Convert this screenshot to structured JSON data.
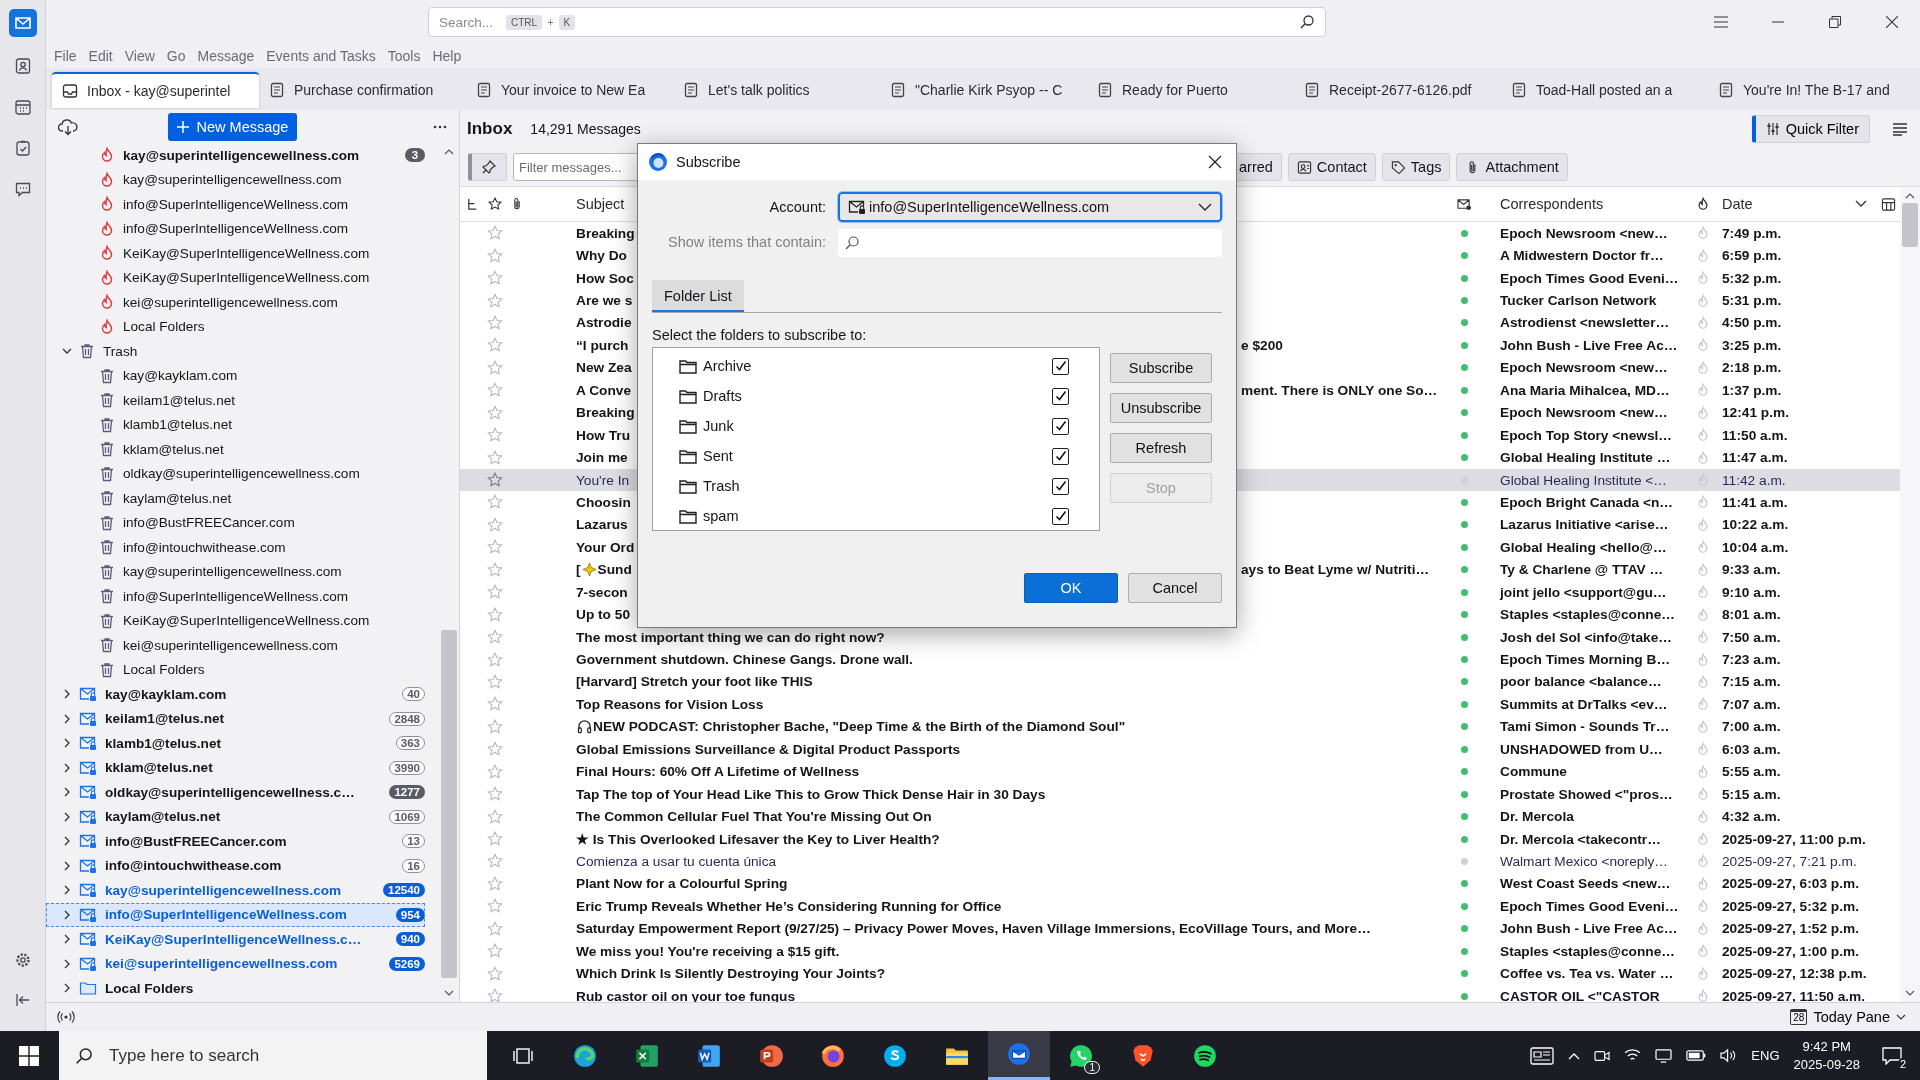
{
  "window": {
    "search_placeholder": "Search...",
    "search_keys": [
      {
        "label": "CTRL",
        "kind": "key"
      },
      {
        "label": "+",
        "kind": "plus"
      },
      {
        "label": "K",
        "kind": "key"
      }
    ]
  },
  "spaces": [
    {
      "kind": "contacts",
      "selected": false
    },
    {
      "kind": "calendar",
      "selected": false
    },
    {
      "kind": "tasks",
      "selected": false
    },
    {
      "kind": "chat",
      "selected": false
    }
  ],
  "menu": [
    "File",
    "Edit",
    "View",
    "Go",
    "Message",
    "Events and Tasks",
    "Tools",
    "Help"
  ],
  "tabs": [
    {
      "label": "Inbox - kay@superintel",
      "kind": "inbox",
      "selected": true
    },
    {
      "label": "Purchase confirmation",
      "kind": "message",
      "selected": false
    },
    {
      "label": "Your invoice to New Ea",
      "kind": "message",
      "selected": false
    },
    {
      "label": "Let's talk politics",
      "kind": "message",
      "selected": false
    },
    {
      "label": "\"Charlie Kirk Psyop -- C",
      "kind": "message",
      "selected": false
    },
    {
      "label": "Ready for Puerto",
      "kind": "message",
      "selected": false
    },
    {
      "label": "Receipt-2677-6126.pdf",
      "kind": "message",
      "selected": false
    },
    {
      "label": "Toad-Hall posted an a",
      "kind": "message",
      "selected": false
    },
    {
      "label": "You're In! The B-17 and",
      "kind": "message",
      "selected": false
    }
  ],
  "folder_pane": {
    "new_message": "New Message",
    "tree": [
      {
        "children": [
          {
            "name": "kay@superintelligencewellness.com",
            "kind": "junk",
            "unread": true,
            "selected": false,
            "count": "3",
            "filled": true
          },
          {
            "name": "kay@superintelligencewellness.com",
            "kind": "junk",
            "unread": false,
            "selected": false
          },
          {
            "name": "info@SuperIntelligenceWellness.com",
            "kind": "junk",
            "unread": false,
            "selected": false
          },
          {
            "name": "info@SuperIntelligenceWellness.com",
            "kind": "junk",
            "unread": false,
            "selected": false
          },
          {
            "name": "KeiKay@SuperIntelligenceWellness.com",
            "kind": "junk",
            "unread": false,
            "selected": false
          },
          {
            "name": "KeiKay@SuperIntelligenceWellness.com",
            "kind": "junk",
            "unread": false,
            "selected": false
          },
          {
            "name": "kei@superintelligencewellness.com",
            "kind": "junk",
            "unread": false,
            "selected": false
          },
          {
            "name": "Local Folders",
            "kind": "junk",
            "unread": false,
            "selected": false
          }
        ]
      },
      {
        "name": "Trash",
        "kind": "trash",
        "expanded": true,
        "unread": false,
        "selected": false,
        "children": [
          {
            "name": "kay@kayklam.com",
            "kind": "trash",
            "unread": false,
            "selected": false
          },
          {
            "name": "keilam1@telus.net",
            "kind": "trash",
            "unread": false,
            "selected": false
          },
          {
            "name": "klamb1@telus.net",
            "kind": "trash",
            "unread": false,
            "selected": false
          },
          {
            "name": "kklam@telus.net",
            "kind": "trash",
            "unread": false,
            "selected": false
          },
          {
            "name": "oldkay@superintelligencewellness.com",
            "kind": "trash",
            "unread": false,
            "selected": false
          },
          {
            "name": "kaylam@telus.net",
            "kind": "trash",
            "unread": false,
            "selected": false
          },
          {
            "name": "info@BustFREECancer.com",
            "kind": "trash",
            "unread": false,
            "selected": false
          },
          {
            "name": "info@intouchwithease.com",
            "kind": "trash",
            "unread": false,
            "selected": false
          },
          {
            "name": "kay@superintelligencewellness.com",
            "kind": "trash",
            "unread": false,
            "selected": false
          },
          {
            "name": "info@SuperIntelligenceWellness.com",
            "kind": "trash",
            "unread": false,
            "selected": false
          },
          {
            "name": "KeiKay@SuperIntelligenceWellness.com",
            "kind": "trash",
            "unread": false,
            "selected": false
          },
          {
            "name": "kei@superintelligencewellness.com",
            "kind": "trash",
            "unread": false,
            "selected": false
          },
          {
            "name": "Local Folders",
            "kind": "trash",
            "unread": false,
            "selected": false
          }
        ]
      },
      {
        "name": "kay@kayklam.com",
        "kind": "account",
        "expanded": false,
        "unread": true,
        "new_mail": false,
        "selected": false,
        "count": "40",
        "filled": false
      },
      {
        "name": "keilam1@telus.net",
        "kind": "account",
        "expanded": false,
        "unread": true,
        "new_mail": false,
        "selected": false,
        "count": "2848",
        "filled": false
      },
      {
        "name": "klamb1@telus.net",
        "kind": "account",
        "expanded": false,
        "unread": true,
        "new_mail": false,
        "selected": false,
        "count": "363",
        "filled": false
      },
      {
        "name": "kklam@telus.net",
        "kind": "account",
        "expanded": false,
        "unread": true,
        "new_mail": false,
        "selected": false,
        "count": "3990",
        "filled": false
      },
      {
        "name": "oldkay@superintelligencewellness.c…",
        "kind": "account",
        "expanded": false,
        "unread": true,
        "new_mail": false,
        "selected": false,
        "count": "1277",
        "filled": true
      },
      {
        "name": "kaylam@telus.net",
        "kind": "account",
        "expanded": false,
        "unread": true,
        "new_mail": false,
        "selected": false,
        "count": "1069",
        "filled": false
      },
      {
        "name": "info@BustFREECancer.com",
        "kind": "account",
        "expanded": false,
        "unread": true,
        "new_mail": false,
        "selected": false,
        "count": "13",
        "filled": false
      },
      {
        "name": "info@intouchwithease.com",
        "kind": "account",
        "expanded": false,
        "unread": true,
        "new_mail": false,
        "selected": false,
        "count": "16",
        "filled": false
      },
      {
        "name": "kay@superintelligencewellness.com",
        "kind": "account",
        "expanded": false,
        "unread": true,
        "new_mail": true,
        "selected": false,
        "count": "12540",
        "filled": true
      },
      {
        "name": "info@SuperIntelligenceWellness.com",
        "kind": "account",
        "expanded": false,
        "unread": true,
        "new_mail": true,
        "selected": true,
        "count": "954",
        "filled": true
      },
      {
        "name": "KeiKay@SuperIntelligenceWellness.c…",
        "kind": "account",
        "expanded": false,
        "unread": true,
        "new_mail": true,
        "selected": false,
        "count": "940",
        "filled": true
      },
      {
        "name": "kei@superintelligencewellness.com",
        "kind": "account",
        "expanded": false,
        "unread": true,
        "new_mail": true,
        "selected": false,
        "count": "5269",
        "filled": true
      },
      {
        "name": "Local Folders",
        "kind": "local",
        "expanded": false,
        "unread": true,
        "new_mail": false,
        "selected": false
      }
    ]
  },
  "message_pane": {
    "folder": "Inbox",
    "count": "14,291 Messages",
    "quick_filter": "Quick Filter",
    "filter_placeholder": "Filter messages...",
    "filters": [
      {
        "label": "arred",
        "kind": "starred"
      },
      {
        "label": "Contact",
        "kind": "contact"
      },
      {
        "label": "Tags",
        "kind": "tags"
      },
      {
        "label": "Attachment",
        "kind": "attachment"
      }
    ],
    "columns": {
      "subject": "Subject",
      "correspondents": "Correspondents",
      "date": "Date"
    },
    "rows": [
      {
        "subject": "Breaking",
        "from": "Epoch Newsroom <new…",
        "date": "7:49 p.m.",
        "unread": true,
        "selected": false
      },
      {
        "subject": "Why Do",
        "from": "A Midwestern Doctor fr…",
        "date": "6:59 p.m.",
        "unread": true,
        "selected": false
      },
      {
        "subject": "How Soc",
        "from": "Epoch Times Good Eveni…",
        "date": "5:32 p.m.",
        "unread": true,
        "selected": false
      },
      {
        "subject": "Are we s",
        "from": "Tucker Carlson Network",
        "date": "5:31 p.m.",
        "unread": true,
        "selected": false
      },
      {
        "subject": "Astrodie",
        "from": "Astrodienst <newsletter…",
        "date": "4:50 p.m.",
        "unread": true,
        "selected": false
      },
      {
        "subject": "“I purch",
        "tail": "e $200",
        "from": "John Bush - Live Free Ac…",
        "date": "3:25 p.m.",
        "unread": true,
        "selected": false
      },
      {
        "subject": "New Zea",
        "from": "Epoch Newsroom <new…",
        "date": "2:18 p.m.",
        "unread": true,
        "selected": false
      },
      {
        "subject": "A Conve",
        "tail": "ment. There is ONLY one So…",
        "from": "Ana Maria Mihalcea, MD…",
        "date": "1:37 p.m.",
        "unread": true,
        "selected": false
      },
      {
        "subject": "Breaking",
        "from": "Epoch Newsroom <new…",
        "date": "12:41 p.m.",
        "unread": true,
        "selected": false
      },
      {
        "subject": "How Tru",
        "from": "Epoch Top Story <newsl…",
        "date": "11:50 a.m.",
        "unread": true,
        "selected": false
      },
      {
        "subject": "Join me",
        "from": "Global Healing Institute …",
        "date": "11:47 a.m.",
        "unread": true,
        "selected": false
      },
      {
        "subject": "You're In",
        "from": "Global Healing Institute <…",
        "date": "11:42 a.m.",
        "unread": false,
        "selected": true
      },
      {
        "subject": "Choosin",
        "from": "Epoch Bright Canada <n…",
        "date": "11:41 a.m.",
        "unread": true,
        "selected": false
      },
      {
        "subject": "Lazarus",
        "from": "Lazarus Initiative <arise…",
        "date": "10:22 a.m.",
        "unread": true,
        "selected": false
      },
      {
        "subject": "Your Ord",
        "from": "Global Healing <hello@…",
        "date": "10:04 a.m.",
        "unread": true,
        "selected": false
      },
      {
        "lead": "[",
        "kind": "sparkle",
        "subject": "Sund",
        "tail": "ays to Beat Lyme w/ Nutriti…",
        "from": "Ty & Charlene @ TTAV …",
        "date": "9:33 a.m.",
        "unread": true,
        "selected": false
      },
      {
        "subject": "7-secon",
        "from": "joint jello <support@gu…",
        "date": "9:10 a.m.",
        "unread": true,
        "selected": false
      },
      {
        "subject": "Up to 50",
        "from": "Staples <staples@conne…",
        "date": "8:01 a.m.",
        "unread": true,
        "selected": false
      },
      {
        "subject": "The most important thing we can do right now?",
        "from": "Josh del Sol <info@take…",
        "date": "7:50 a.m.",
        "unread": true,
        "selected": false
      },
      {
        "subject": "Government shutdown. Chinese Gangs. Drone wall.",
        "from": "Epoch Times Morning B…",
        "date": "7:23 a.m.",
        "unread": true,
        "selected": false
      },
      {
        "subject": "[Harvard] Stretch your foot like THIS",
        "from": "poor balance <balance…",
        "date": "7:15 a.m.",
        "unread": true,
        "selected": false
      },
      {
        "subject": "Top Reasons for Vision Loss",
        "from": "Summits at DrTalks <ev…",
        "date": "7:07 a.m.",
        "unread": true,
        "selected": false
      },
      {
        "kind": "headphones",
        "subject": "NEW PODCAST: Christopher Bache, \"Deep Time & the Birth of the Diamond Soul\"",
        "from": "Tami Simon - Sounds Tr…",
        "date": "7:00 a.m.",
        "unread": true,
        "selected": false
      },
      {
        "subject": "Global Emissions Surveillance & Digital Product Passports",
        "from": "UNSHADOWED from U…",
        "date": "6:03 a.m.",
        "unread": true,
        "selected": false
      },
      {
        "subject": "Final Hours: 60% Off A Lifetime of Wellness",
        "from": "Commune",
        "date": "5:55 a.m.",
        "unread": true,
        "selected": false
      },
      {
        "subject": "Tap The top of Your Head Like This to Grow Thick Dense Hair in 30 Days",
        "from": "Prostate Showed <\"pros…",
        "date": "5:15 a.m.",
        "unread": true,
        "selected": false
      },
      {
        "subject": "The Common Cellular Fuel That You're Missing Out On",
        "from": "Dr. Mercola",
        "date": "4:32 a.m.",
        "unread": true,
        "selected": false
      },
      {
        "subject": "★ Is This Overlooked Lifesaver the Key to Liver Health?",
        "from": "Dr. Mercola <takecontr…",
        "date": "2025-09-27, 11:00 p.m.",
        "unread": true,
        "selected": false
      },
      {
        "subject": "Comienza a usar tu cuenta única",
        "from": "Walmart Mexico <noreply…",
        "date": "2025-09-27, 7:21 p.m.",
        "unread": false,
        "selected": false
      },
      {
        "subject": "Plant Now for a Colourful Spring",
        "from": "West Coast Seeds <new…",
        "date": "2025-09-27, 6:03 p.m.",
        "unread": true,
        "selected": false
      },
      {
        "subject": "Eric Trump Reveals Whether He’s Considering Running for Office",
        "from": "Epoch Times Good Eveni…",
        "date": "2025-09-27, 5:32 p.m.",
        "unread": true,
        "selected": false
      },
      {
        "subject": "Saturday Empowerment Report (9/27/25) – Privacy Power Moves, Haven Village Immersions, EcoVillage Tours, and More…",
        "from": "John Bush - Live Free Ac…",
        "date": "2025-09-27, 1:52 p.m.",
        "unread": true,
        "selected": false
      },
      {
        "subject": "We miss you! You're receiving a $15 gift.",
        "from": "Staples <staples@conne…",
        "date": "2025-09-27, 1:00 p.m.",
        "unread": true,
        "selected": false
      },
      {
        "subject": "Which Drink Is Silently Destroying Your Joints?",
        "from": "Coffee vs. Tea vs. Water …",
        "date": "2025-09-27, 12:38 p.m.",
        "unread": true,
        "selected": false
      },
      {
        "subject": "Rub castor oil on your toe fungus",
        "from": "CASTOR OIL <\"CASTOR",
        "date": "2025-09-27, 11:50 a.m.",
        "unread": true,
        "selected": false
      }
    ]
  },
  "dialog": {
    "title": "Subscribe",
    "account_label": "Account:",
    "account": "info@SuperIntelligenceWellness.com",
    "filter_label": "Show items that contain:",
    "tabs": [
      {
        "label": "Folder List",
        "selected": true
      }
    ],
    "prompt": "Select the folders to subscribe to:",
    "folders": [
      {
        "name": "Archive",
        "checked": true
      },
      {
        "name": "Drafts",
        "checked": true
      },
      {
        "name": "Junk",
        "checked": true
      },
      {
        "name": "Sent",
        "checked": true
      },
      {
        "name": "Trash",
        "checked": true
      },
      {
        "name": "spam",
        "checked": true
      }
    ],
    "actions": [
      {
        "label": "Subscribe",
        "disabled": false
      },
      {
        "label": "Unsubscribe",
        "disabled": false
      },
      {
        "label": "Refresh",
        "disabled": false
      },
      {
        "label": "Stop",
        "disabled": true
      }
    ],
    "buttons": [
      {
        "label": "OK",
        "kind": "primary"
      },
      {
        "label": "Cancel",
        "kind": "secondary"
      }
    ]
  },
  "status_bar": {
    "today_pane": "Today Pane",
    "day": "28"
  },
  "taskbar": {
    "search_placeholder": "Type here to search",
    "apps": [
      {
        "kind": "taskview",
        "active": false
      },
      {
        "kind": "edge",
        "active": false
      },
      {
        "kind": "excel",
        "active": false
      },
      {
        "kind": "word",
        "active": false
      },
      {
        "kind": "powerpoint",
        "active": false
      },
      {
        "kind": "firefox",
        "active": false
      },
      {
        "kind": "skype",
        "active": false
      },
      {
        "kind": "explorer",
        "active": false
      },
      {
        "kind": "thunderbird",
        "active": true
      },
      {
        "kind": "whatsapp",
        "active": false,
        "badge": "1"
      },
      {
        "kind": "brave",
        "active": false
      },
      {
        "kind": "spotify",
        "active": false
      }
    ],
    "language": "ENG",
    "time": "9:42 PM",
    "date": "2025-09-28",
    "notifications": "2"
  }
}
